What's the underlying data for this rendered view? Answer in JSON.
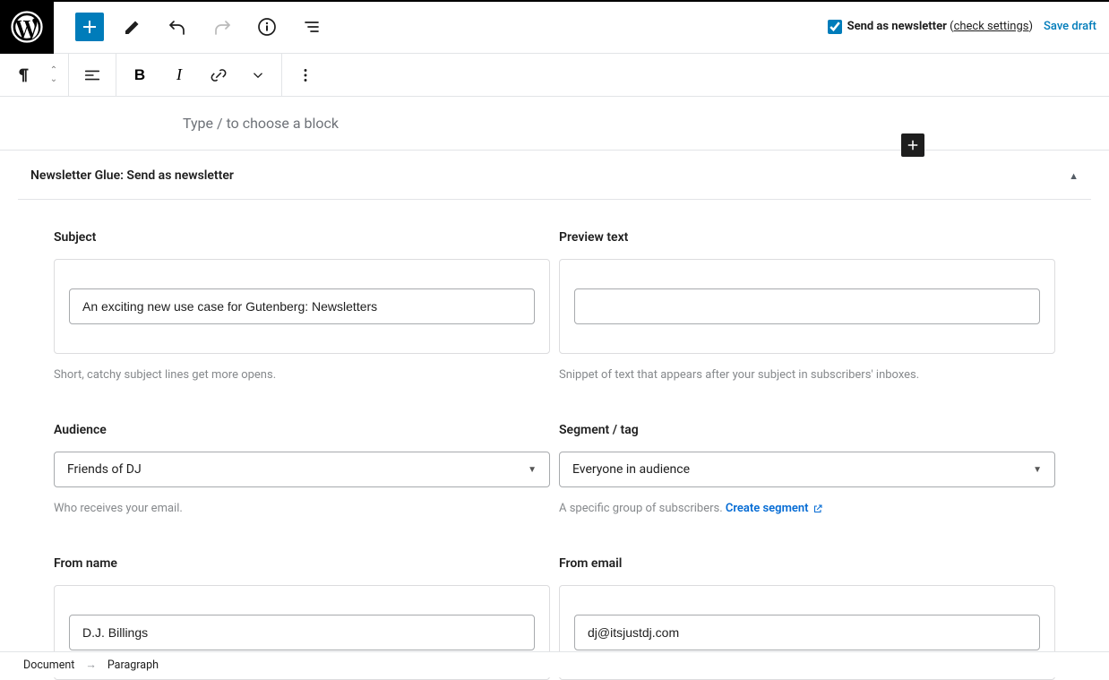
{
  "colors": {
    "accent": "#007cba"
  },
  "topbar": {
    "send_label": "Send as newsletter",
    "check_settings": "check settings",
    "save_draft": "Save draft"
  },
  "canvas": {
    "placeholder": "Type / to choose a block"
  },
  "panel": {
    "title": "Newsletter Glue: Send as newsletter"
  },
  "fields": {
    "subject": {
      "label": "Subject",
      "value": "An exciting new use case for Gutenberg: Newsletters",
      "help": "Short, catchy subject lines get more opens."
    },
    "preview": {
      "label": "Preview text",
      "value": "",
      "help": "Snippet of text that appears after your subject in subscribers' inboxes."
    },
    "audience": {
      "label": "Audience",
      "value": "Friends of DJ",
      "help": "Who receives your email."
    },
    "segment": {
      "label": "Segment / tag",
      "value": "Everyone in audience",
      "help_prefix": "A specific group of subscribers. ",
      "help_link": "Create segment"
    },
    "from_name": {
      "label": "From name",
      "value": "D.J. Billings"
    },
    "from_email": {
      "label": "From email",
      "value": "dj@itsjustdj.com"
    }
  },
  "breadcrumb": {
    "document": "Document",
    "current": "Paragraph"
  }
}
